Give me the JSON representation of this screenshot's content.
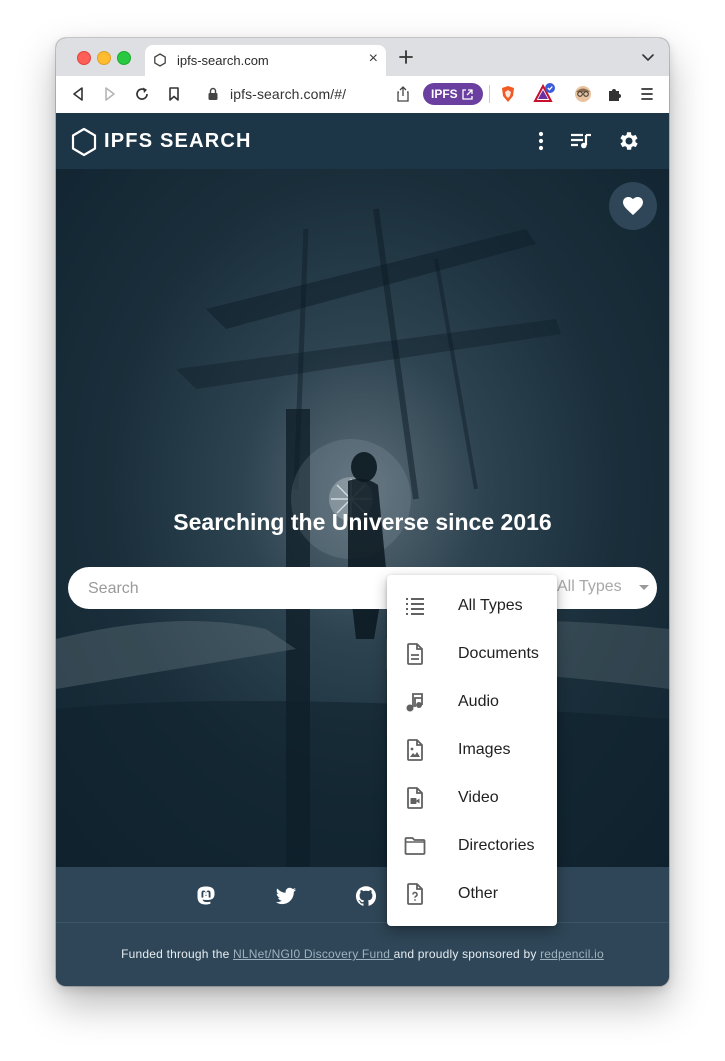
{
  "browser": {
    "tab": {
      "title": "ipfs-search.com"
    },
    "url": "ipfs-search.com/#/",
    "ipfs_badge": "IPFS"
  },
  "site": {
    "logo_text": "IPFS SEARCH",
    "tagline": "Searching the Universe since 2016",
    "search": {
      "placeholder": "Search",
      "type_selected": "All Types"
    },
    "type_menu": [
      {
        "label": "All Types",
        "icon": "list-icon"
      },
      {
        "label": "Documents",
        "icon": "document-icon"
      },
      {
        "label": "Audio",
        "icon": "music-note-icon"
      },
      {
        "label": "Images",
        "icon": "image-file-icon"
      },
      {
        "label": "Video",
        "icon": "video-file-icon"
      },
      {
        "label": "Directories",
        "icon": "folder-icon"
      },
      {
        "label": "Other",
        "icon": "unknown-file-icon"
      }
    ],
    "footer": {
      "prefix": "Funded through the ",
      "fund_link": "NLNet/NGI0 Discovery Fund ",
      "middle": "and proudly sponsored by ",
      "sponsor_link": "redpencil.io"
    }
  },
  "colors": {
    "header_bg": "#1c3547",
    "footer_bg": "#2e4657",
    "ipfs_badge": "#6b3fa0",
    "text_primary": "#212121"
  }
}
